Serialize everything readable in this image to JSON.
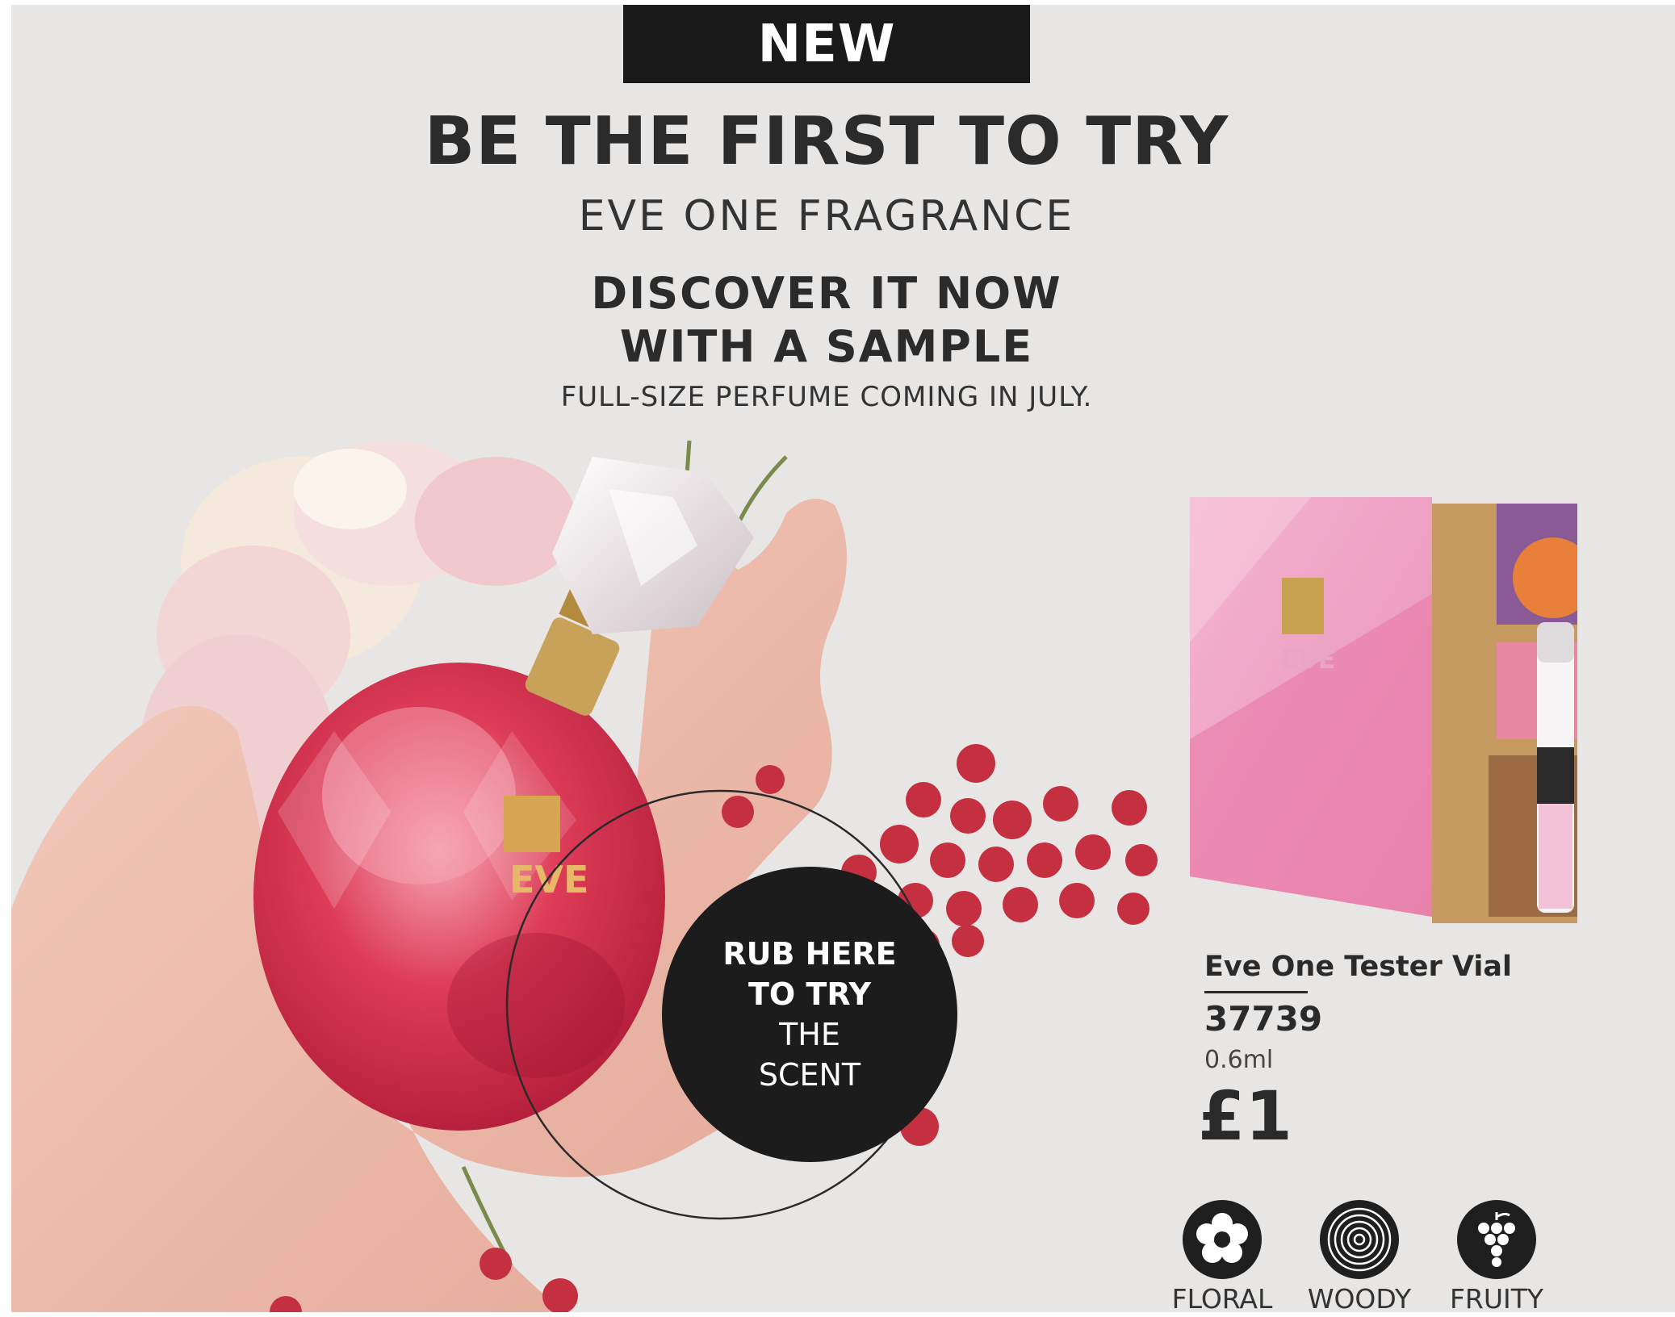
{
  "header": {
    "badge": "NEW",
    "headline": "BE THE FIRST TO TRY",
    "subheadline": "EVE ONE FRAGRANCE",
    "discover_line1": "DISCOVER IT NOW",
    "discover_line2": "WITH A SAMPLE",
    "coming_note": "FULL-SIZE PERFUME COMING IN JULY."
  },
  "rub_prompt": {
    "line1": "RUB HERE",
    "line2": "TO TRY",
    "line3": "THE",
    "line4": "SCENT"
  },
  "bottle_label": "EVE",
  "product": {
    "name": "Eve One Tester Vial",
    "code": "37739",
    "size": "0.6ml",
    "price": "£1",
    "packaging_label": "EVE"
  },
  "notes": [
    {
      "label": "FLORAL",
      "icon": "flower-icon"
    },
    {
      "label": "WOODY",
      "icon": "wood-rings-icon"
    },
    {
      "label": "FRUITY",
      "icon": "grapes-icon"
    }
  ],
  "colors": {
    "background": "#e8e6e4",
    "badge": "#1a1a1a",
    "text": "#2b2b2b",
    "perfume": "#d8354f",
    "berries": "#c53040",
    "sachet": "#efa3c4"
  }
}
